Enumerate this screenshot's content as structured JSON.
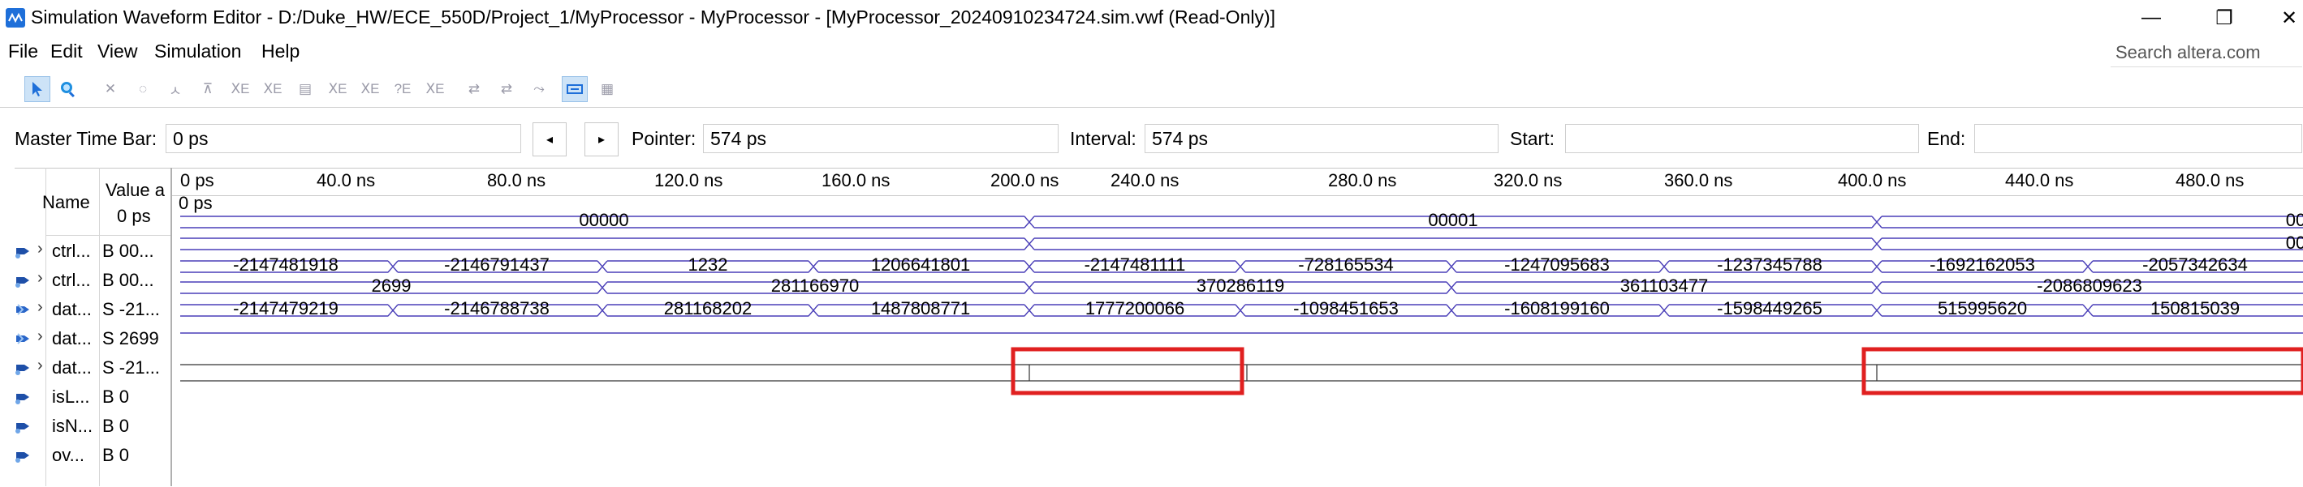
{
  "window": {
    "title": "Simulation Waveform Editor - D:/Duke_HW/ECE_550D/Project_1/MyProcessor - MyProcessor - [MyProcessor_20240910234724.sim.vwf (Read-Only)]",
    "minimize": "—",
    "maximize": "❐",
    "close": "✕"
  },
  "menu": [
    "File",
    "Edit",
    "View",
    "Simulation",
    "Help"
  ],
  "search": {
    "placeholder": "Search altera.com"
  },
  "toolbar": {
    "icons": [
      "selection-tool-icon",
      "zoom-tool-icon",
      "forcing-low-icon",
      "forcing-high-icon",
      "forcing-unknown-icon",
      "forcing-zero-icon",
      "invert-icon",
      "count-value-icon",
      "clock-icon",
      "random-value-icon",
      "arbitrary-value-icon",
      "weak-high-icon",
      "weak-low-icon",
      "high-impedance-icon",
      "snap-to-grid-icon",
      "run-functional-icon",
      "run-timing-icon",
      "snap-grid-toggle-icon",
      "group-icon"
    ]
  },
  "master_bar": {
    "master_label": "Master Time Bar:",
    "master_value": "0 ps",
    "prev": "◂",
    "next": "▸",
    "pointer_label": "Pointer:",
    "pointer_value": "574 ps",
    "interval_label": "Interval:",
    "interval_value": "574 ps",
    "start_label": "Start:",
    "start_value": "",
    "end_label": "End:",
    "end_value": ""
  },
  "columns": {
    "name": "Name",
    "value_line1": "Value a",
    "value_line2": "0 ps"
  },
  "ruler": {
    "cursor_label": "0 ps",
    "ticks": [
      "0 ps",
      "40.0 ns",
      "80.0 ns",
      "120.0 ns",
      "160.0 ns",
      "200.0 ns",
      "240.0 ns",
      "280.0 ns",
      "320.0 ns",
      "360.0 ns",
      "400.0 ns",
      "440.0 ns",
      "480.0 ns"
    ]
  },
  "signals": [
    {
      "name": "ctrl...",
      "value": "B 00...",
      "icon": "output-bus-icon"
    },
    {
      "name": "ctrl...",
      "value": "B 00...",
      "icon": "output-bus-icon"
    },
    {
      "name": "dat...",
      "value": "S -21...",
      "icon": "input-bus-icon"
    },
    {
      "name": "dat...",
      "value": "S 2699",
      "icon": "input-bus-icon"
    },
    {
      "name": "dat...",
      "value": "S -21...",
      "icon": "output-bus-icon"
    },
    {
      "name": "isL...",
      "value": "B 0",
      "icon": "output-pin-icon"
    },
    {
      "name": "isN...",
      "value": "B 0",
      "icon": "output-pin-icon"
    },
    {
      "name": "ov...",
      "value": "B 0",
      "icon": "output-pin-icon"
    }
  ],
  "waves": {
    "ctrl1": [
      "00000",
      "00001",
      "00"
    ],
    "ctrl2": [
      "",
      "",
      "00"
    ],
    "ctrl2_lower": [
      "-2147481918",
      "-2146791437",
      "1232",
      "1206641801",
      "-2147481111",
      "-728165534",
      "-1247095683",
      "-1237345788",
      "-1692162053",
      "-2057342634"
    ],
    "dataA": [
      "2699",
      "281166970",
      "370286119",
      "361103477",
      "-2086809623"
    ],
    "dataB": [
      "-2147479219",
      "-2146788738",
      "281168202",
      "1487808771",
      "1777200066",
      "-1098451653",
      "-1608199160",
      "-1598449265",
      "515995620",
      "150815039"
    ]
  },
  "colors": {
    "wave": "#4a3fb8",
    "highlight": "#e02020",
    "accent": "#1e6fd9"
  }
}
